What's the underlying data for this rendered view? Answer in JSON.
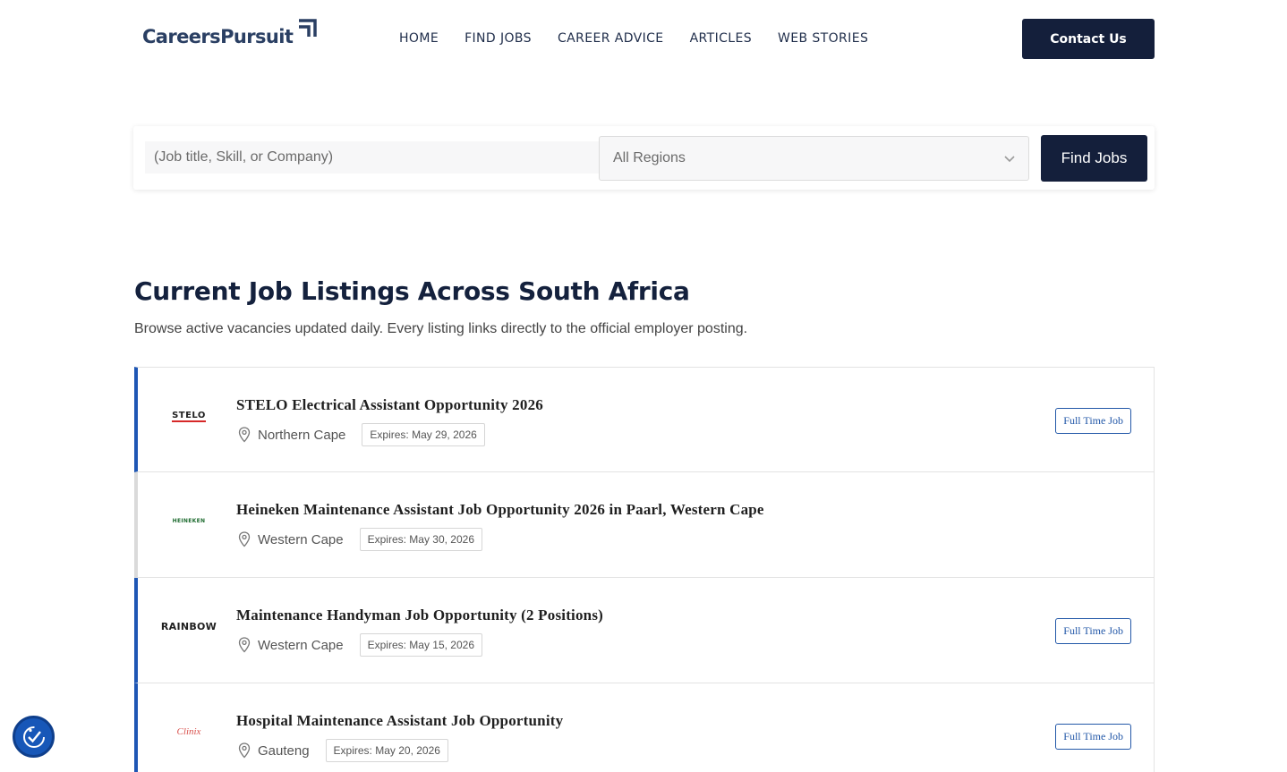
{
  "brand": {
    "logo_text": "CareersPursuit",
    "colors": {
      "navy": "#141f3b",
      "accent_blue": "#1e56b4",
      "logo_text": "#2a3f63"
    }
  },
  "nav": {
    "items": [
      {
        "label": "HOME"
      },
      {
        "label": "FIND JOBS"
      },
      {
        "label": "CAREER ADVICE"
      },
      {
        "label": "ARTICLES"
      },
      {
        "label": "WEB STORIES"
      }
    ],
    "contact_label": "Contact Us"
  },
  "search": {
    "keyword_placeholder": "(Job title, Skill, or Company)",
    "region_selected": "All Regions",
    "submit_label": "Find Jobs"
  },
  "section": {
    "title": "Current Job Listings Across South Africa",
    "subtitle": "Browse active vacancies updated daily. Every listing links directly to the official employer posting."
  },
  "jobs": [
    {
      "logo_text": "STELO",
      "title": "STELO Electrical Assistant Opportunity 2026",
      "location": "Northern Cape",
      "expires": "Expires: May 29, 2026",
      "type": "Full Time Job"
    },
    {
      "logo_text": "HEINEKEN",
      "title": "Heineken Maintenance Assistant Job Opportunity 2026 in Paarl, Western Cape",
      "location": "Western Cape",
      "expires": "Expires: May 30, 2026",
      "type": ""
    },
    {
      "logo_text": "RAINBOW",
      "title": "Maintenance Handyman Job Opportunity (2 Positions)",
      "location": "Western Cape",
      "expires": "Expires: May 15, 2026",
      "type": "Full Time Job"
    },
    {
      "logo_text": "Clinix",
      "title": "Hospital Maintenance Assistant Job Opportunity",
      "location": "Gauteng",
      "expires": "Expires: May 20, 2026",
      "type": "Full Time Job"
    }
  ],
  "icons": {
    "logo_mark": "arrow-up-right-icon",
    "region_dropdown": "chevron-down-icon",
    "location": "map-pin-icon",
    "accessibility": "accessibility-check-icon"
  }
}
